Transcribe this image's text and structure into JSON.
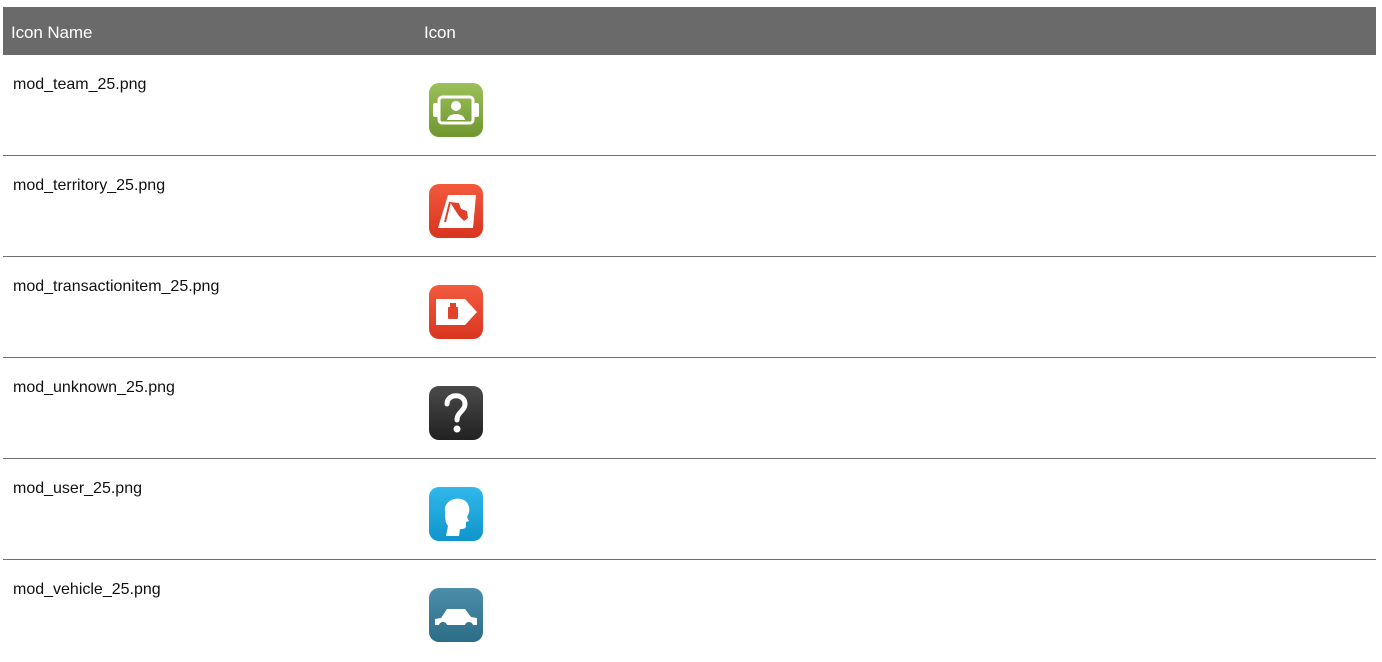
{
  "table": {
    "headers": {
      "name": "Icon Name",
      "icon": "Icon"
    },
    "rows": [
      {
        "name": "mod_team_25.png",
        "icon": "team-icon",
        "color": "#7aa33a"
      },
      {
        "name": "mod_territory_25.png",
        "icon": "territory-icon",
        "color": "#e8452f"
      },
      {
        "name": "mod_transactionitem_25.png",
        "icon": "transaction-item-icon",
        "color": "#ea4a32"
      },
      {
        "name": "mod_unknown_25.png",
        "icon": "unknown-icon",
        "color": "#2f2f2f"
      },
      {
        "name": "mod_user_25.png",
        "icon": "user-icon",
        "color": "#1aa7de"
      },
      {
        "name": "mod_vehicle_25.png",
        "icon": "vehicle-icon",
        "color": "#3a7d98"
      }
    ]
  }
}
